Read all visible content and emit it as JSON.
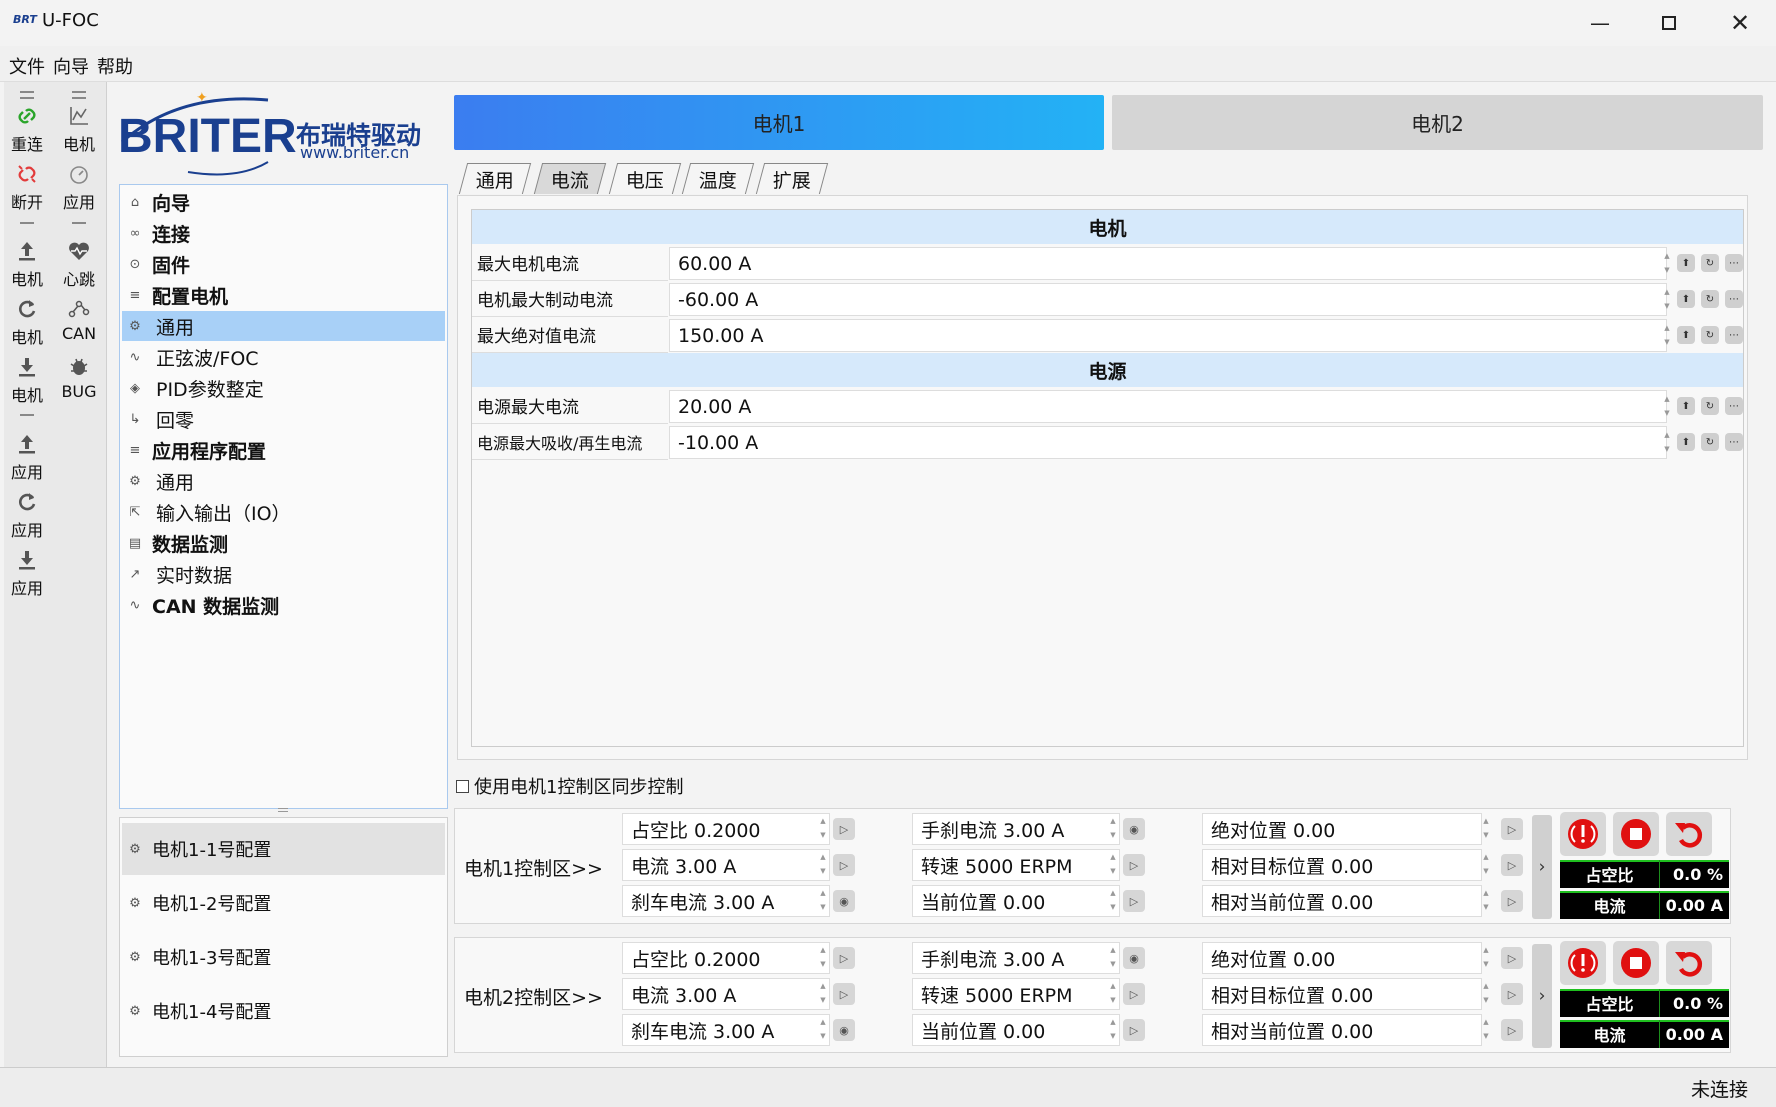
{
  "window": {
    "logo": "BRT",
    "title": "U-FOC"
  },
  "menu": [
    "文件",
    "向导",
    "帮助"
  ],
  "toolbar": {
    "left": [
      {
        "label": "重连",
        "icon": "link-icon",
        "color": "#2aa52a"
      },
      {
        "label": "断开",
        "icon": "unlink-icon",
        "color": "#e23b3b"
      },
      {
        "label": "电机",
        "icon": "upload-icon"
      },
      {
        "label": "电机",
        "icon": "refresh-icon"
      },
      {
        "label": "电机",
        "icon": "download-icon"
      },
      {
        "label": "应用",
        "icon": "upload-icon"
      },
      {
        "label": "应用",
        "icon": "refresh-icon"
      },
      {
        "label": "应用",
        "icon": "download-icon"
      }
    ],
    "right": [
      {
        "label": "电机",
        "icon": "chart-icon"
      },
      {
        "label": "应用",
        "icon": "gauge-icon"
      },
      {
        "label": "心跳",
        "icon": "heartbeat-icon"
      },
      {
        "label": "CAN",
        "icon": "network-icon"
      },
      {
        "label": "BUG",
        "icon": "bug-icon"
      }
    ]
  },
  "brand": {
    "name": "BRITER",
    "cn": "布瑞特驱动",
    "url": "www.briter.cn"
  },
  "nav": [
    {
      "label": "向导",
      "bold": true,
      "icon": "home-icon"
    },
    {
      "label": "连接",
      "bold": true,
      "icon": "link-icon"
    },
    {
      "label": "固件",
      "bold": true,
      "icon": "chip-icon"
    },
    {
      "label": "配置电机",
      "bold": true,
      "icon": "sliders-icon"
    },
    {
      "label": "通用",
      "bold": false,
      "icon": "gear-icon",
      "selected": true
    },
    {
      "label": "正弦波/FOC",
      "bold": false,
      "icon": "sine-icon"
    },
    {
      "label": "PID参数整定",
      "bold": false,
      "icon": "tune-icon"
    },
    {
      "label": "回零",
      "bold": false,
      "icon": "home-return-icon"
    },
    {
      "label": "应用程序配置",
      "bold": true,
      "icon": "sliders-icon"
    },
    {
      "label": "通用",
      "bold": false,
      "icon": "gear-icon"
    },
    {
      "label": "输入输出（IO）",
      "bold": false,
      "icon": "expand-icon"
    },
    {
      "label": "数据监测",
      "bold": true,
      "icon": "monitor-icon"
    },
    {
      "label": "实时数据",
      "bold": false,
      "icon": "chart-icon"
    },
    {
      "label": "CAN 数据监测",
      "bold": true,
      "icon": "network-icon"
    }
  ],
  "configs": [
    "电机1-1号配置",
    "电机1-2号配置",
    "电机1-3号配置",
    "电机1-4号配置"
  ],
  "motor_tabs": [
    "电机1",
    "电机2"
  ],
  "sub_tabs": [
    "通用",
    "电流",
    "电压",
    "温度",
    "扩展"
  ],
  "active_sub_tab": 1,
  "sections": [
    {
      "title": "电机",
      "rows": [
        {
          "label": "最大电机电流",
          "value": "60.00 A"
        },
        {
          "label": "电机最大制动电流",
          "value": "-60.00 A"
        },
        {
          "label": "最大绝对值电流",
          "value": "150.00 A"
        }
      ]
    },
    {
      "title": "电源",
      "rows": [
        {
          "label": "电源最大电流",
          "value": "20.00 A"
        },
        {
          "label": "电源最大吸收/再生电流",
          "value": "-10.00 A"
        }
      ]
    }
  ],
  "sync_label": "使用电机1控制区同步控制",
  "zones": [
    {
      "title": "电机1控制区>>",
      "cols": [
        [
          "占空比 0.2000",
          "电流 3.00 A",
          "刹车电流 3.00 A"
        ],
        [
          "手刹电流 3.00 A",
          "转速 5000 ERPM",
          "当前位置 0.00"
        ],
        [
          "绝对位置 0.00",
          "相对目标位置 0.00",
          "相对当前位置 0.00"
        ]
      ],
      "meters": [
        {
          "label": "占空比",
          "value": "0.0 %"
        },
        {
          "label": "电流",
          "value": "0.00 A"
        }
      ]
    },
    {
      "title": "电机2控制区>>",
      "cols": [
        [
          "占空比 0.2000",
          "电流 3.00 A",
          "刹车电流 3.00 A"
        ],
        [
          "手刹电流 3.00 A",
          "转速 5000 ERPM",
          "当前位置 0.00"
        ],
        [
          "绝对位置 0.00",
          "相对目标位置 0.00",
          "相对当前位置 0.00"
        ]
      ],
      "meters": [
        {
          "label": "占空比",
          "value": "0.0 %"
        },
        {
          "label": "电流",
          "value": "0.00 A"
        }
      ]
    }
  ],
  "status": "未连接",
  "colors": {
    "accent": "#3a8ef5",
    "selected": "#a8d0f7",
    "danger": "#e01010"
  }
}
